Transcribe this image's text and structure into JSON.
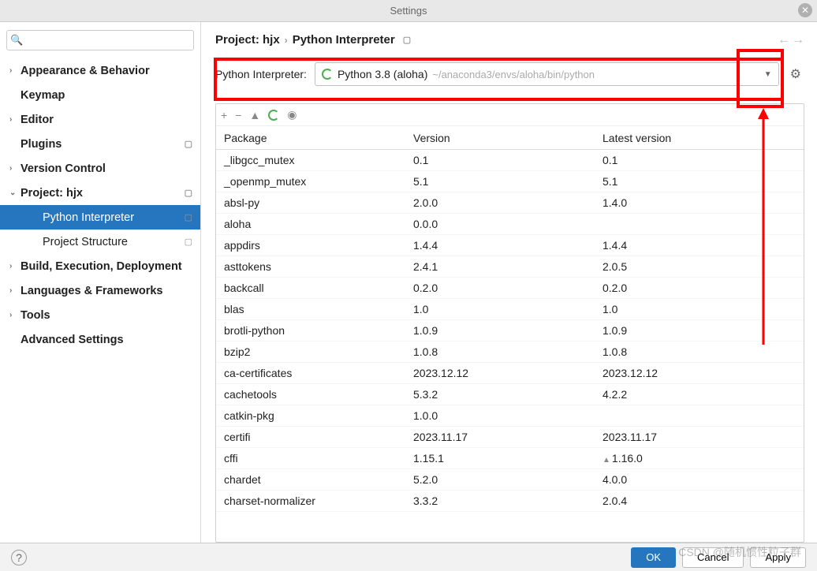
{
  "window": {
    "title": "Settings"
  },
  "search": {
    "placeholder": ""
  },
  "sidebar": {
    "items": [
      {
        "label": "Appearance & Behavior",
        "arrow": true
      },
      {
        "label": "Keymap",
        "arrow": false
      },
      {
        "label": "Editor",
        "arrow": true
      },
      {
        "label": "Plugins",
        "arrow": false,
        "sep": true
      },
      {
        "label": "Version Control",
        "arrow": true
      },
      {
        "label": "Project: hjx",
        "arrow": true,
        "expanded": true,
        "sep": true
      },
      {
        "label": "Python Interpreter",
        "child": true,
        "selected": true,
        "sep": true
      },
      {
        "label": "Project Structure",
        "child": true,
        "sep": true
      },
      {
        "label": "Build, Execution, Deployment",
        "arrow": true
      },
      {
        "label": "Languages & Frameworks",
        "arrow": true
      },
      {
        "label": "Tools",
        "arrow": true
      },
      {
        "label": "Advanced Settings",
        "arrow": false
      }
    ]
  },
  "breadcrumb": {
    "root": "Project: hjx",
    "leaf": "Python Interpreter"
  },
  "interpreter": {
    "label": "Python Interpreter:",
    "name": "Python 3.8 (aloha)",
    "path": "~/anaconda3/envs/aloha/bin/python"
  },
  "packages": {
    "headers": {
      "package": "Package",
      "version": "Version",
      "latest": "Latest version"
    },
    "rows": [
      {
        "name": "_libgcc_mutex",
        "version": "0.1",
        "latest": "0.1"
      },
      {
        "name": "_openmp_mutex",
        "version": "5.1",
        "latest": "5.1"
      },
      {
        "name": "absl-py",
        "version": "2.0.0",
        "latest": "1.4.0"
      },
      {
        "name": "aloha",
        "version": "0.0.0",
        "latest": ""
      },
      {
        "name": "appdirs",
        "version": "1.4.4",
        "latest": "1.4.4"
      },
      {
        "name": "asttokens",
        "version": "2.4.1",
        "latest": "2.0.5"
      },
      {
        "name": "backcall",
        "version": "0.2.0",
        "latest": "0.2.0"
      },
      {
        "name": "blas",
        "version": "1.0",
        "latest": "1.0"
      },
      {
        "name": "brotli-python",
        "version": "1.0.9",
        "latest": "1.0.9"
      },
      {
        "name": "bzip2",
        "version": "1.0.8",
        "latest": "1.0.8"
      },
      {
        "name": "ca-certificates",
        "version": "2023.12.12",
        "latest": "2023.12.12"
      },
      {
        "name": "cachetools",
        "version": "5.3.2",
        "latest": "4.2.2"
      },
      {
        "name": "catkin-pkg",
        "version": "1.0.0",
        "latest": ""
      },
      {
        "name": "certifi",
        "version": "2023.11.17",
        "latest": "2023.11.17"
      },
      {
        "name": "cffi",
        "version": "1.15.1",
        "latest": "1.16.0",
        "upgrade": true
      },
      {
        "name": "chardet",
        "version": "5.2.0",
        "latest": "4.0.0"
      },
      {
        "name": "charset-normalizer",
        "version": "3.3.2",
        "latest": "2.0.4"
      }
    ]
  },
  "footer": {
    "ok": "OK",
    "cancel": "Cancel",
    "apply": "Apply"
  },
  "watermark": "CSDN @随机惯性粒子群"
}
